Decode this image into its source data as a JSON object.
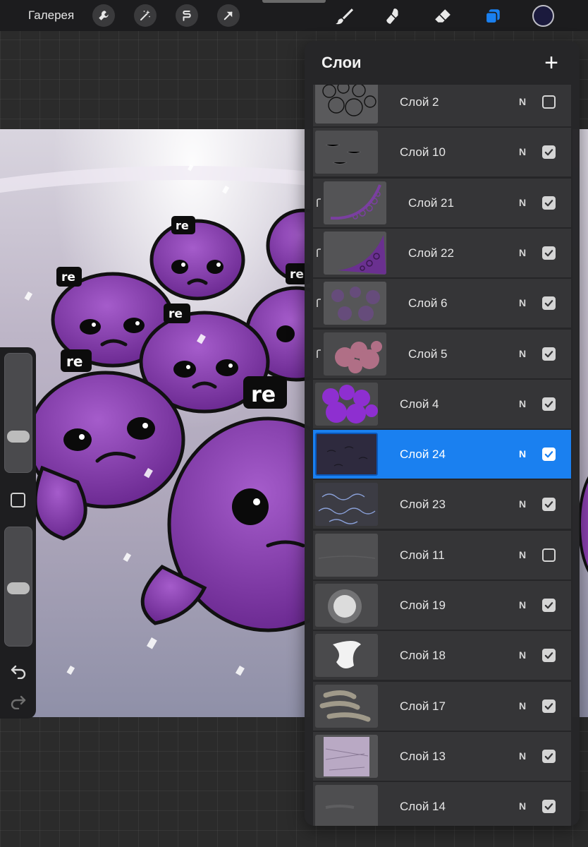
{
  "toolbar": {
    "gallery_label": "Галерея",
    "actions": [
      {
        "icon": "wrench-icon"
      },
      {
        "icon": "magic-wand-icon"
      },
      {
        "icon": "selection-icon"
      },
      {
        "icon": "transform-arrow-icon"
      }
    ],
    "tools": [
      {
        "icon": "brush-icon"
      },
      {
        "icon": "smudge-icon"
      },
      {
        "icon": "eraser-icon"
      },
      {
        "icon": "layers-icon",
        "active": true
      }
    ],
    "current_color": "#1b1a3d"
  },
  "artwork": {
    "hat_text": "re",
    "creature_color": "#8a3fb0"
  },
  "sidebar": {
    "brush_size_level": 0.28,
    "opacity_level": 0.49,
    "undo_icon": "undo-arrow-icon",
    "redo_icon": "redo-arrow-icon"
  },
  "layers_panel": {
    "title": "Слои",
    "add_icon": "+",
    "layers": [
      {
        "name": "Слой 2",
        "blend": "N",
        "visible": false,
        "clipped": false,
        "selected": false,
        "thumb": "sketch"
      },
      {
        "name": "Слой 10",
        "blend": "N",
        "visible": true,
        "clipped": false,
        "selected": false,
        "thumb": "faint"
      },
      {
        "name": "Слой 21",
        "blend": "N",
        "visible": true,
        "clipped": true,
        "selected": false,
        "thumb": "tentacle"
      },
      {
        "name": "Слой 22",
        "blend": "N",
        "visible": true,
        "clipped": true,
        "selected": false,
        "thumb": "tentacle2"
      },
      {
        "name": "Слой 6",
        "blend": "N",
        "visible": true,
        "clipped": true,
        "selected": false,
        "thumb": "shading"
      },
      {
        "name": "Слой 5",
        "blend": "N",
        "visible": true,
        "clipped": true,
        "selected": false,
        "thumb": "blobs"
      },
      {
        "name": "Слой 4",
        "blend": "N",
        "visible": true,
        "clipped": false,
        "selected": false,
        "thumb": "purple"
      },
      {
        "name": "Слой 24",
        "blend": "N",
        "visible": true,
        "clipped": false,
        "selected": true,
        "thumb": "dark"
      },
      {
        "name": "Слой 23",
        "blend": "N",
        "visible": true,
        "clipped": false,
        "selected": false,
        "thumb": "blue-lines"
      },
      {
        "name": "Слой 11",
        "blend": "N",
        "visible": false,
        "clipped": false,
        "selected": false,
        "thumb": "empty"
      },
      {
        "name": "Слой 19",
        "blend": "N",
        "visible": true,
        "clipped": false,
        "selected": false,
        "thumb": "glow"
      },
      {
        "name": "Слой 18",
        "blend": "N",
        "visible": true,
        "clipped": false,
        "selected": false,
        "thumb": "cloud"
      },
      {
        "name": "Слой 17",
        "blend": "N",
        "visible": true,
        "clipped": false,
        "selected": false,
        "thumb": "scribble"
      },
      {
        "name": "Слой 13",
        "blend": "N",
        "visible": true,
        "clipped": false,
        "selected": false,
        "thumb": "texture"
      },
      {
        "name": "Слой 14",
        "blend": "N",
        "visible": true,
        "clipped": false,
        "selected": false,
        "thumb": "grey"
      }
    ]
  }
}
